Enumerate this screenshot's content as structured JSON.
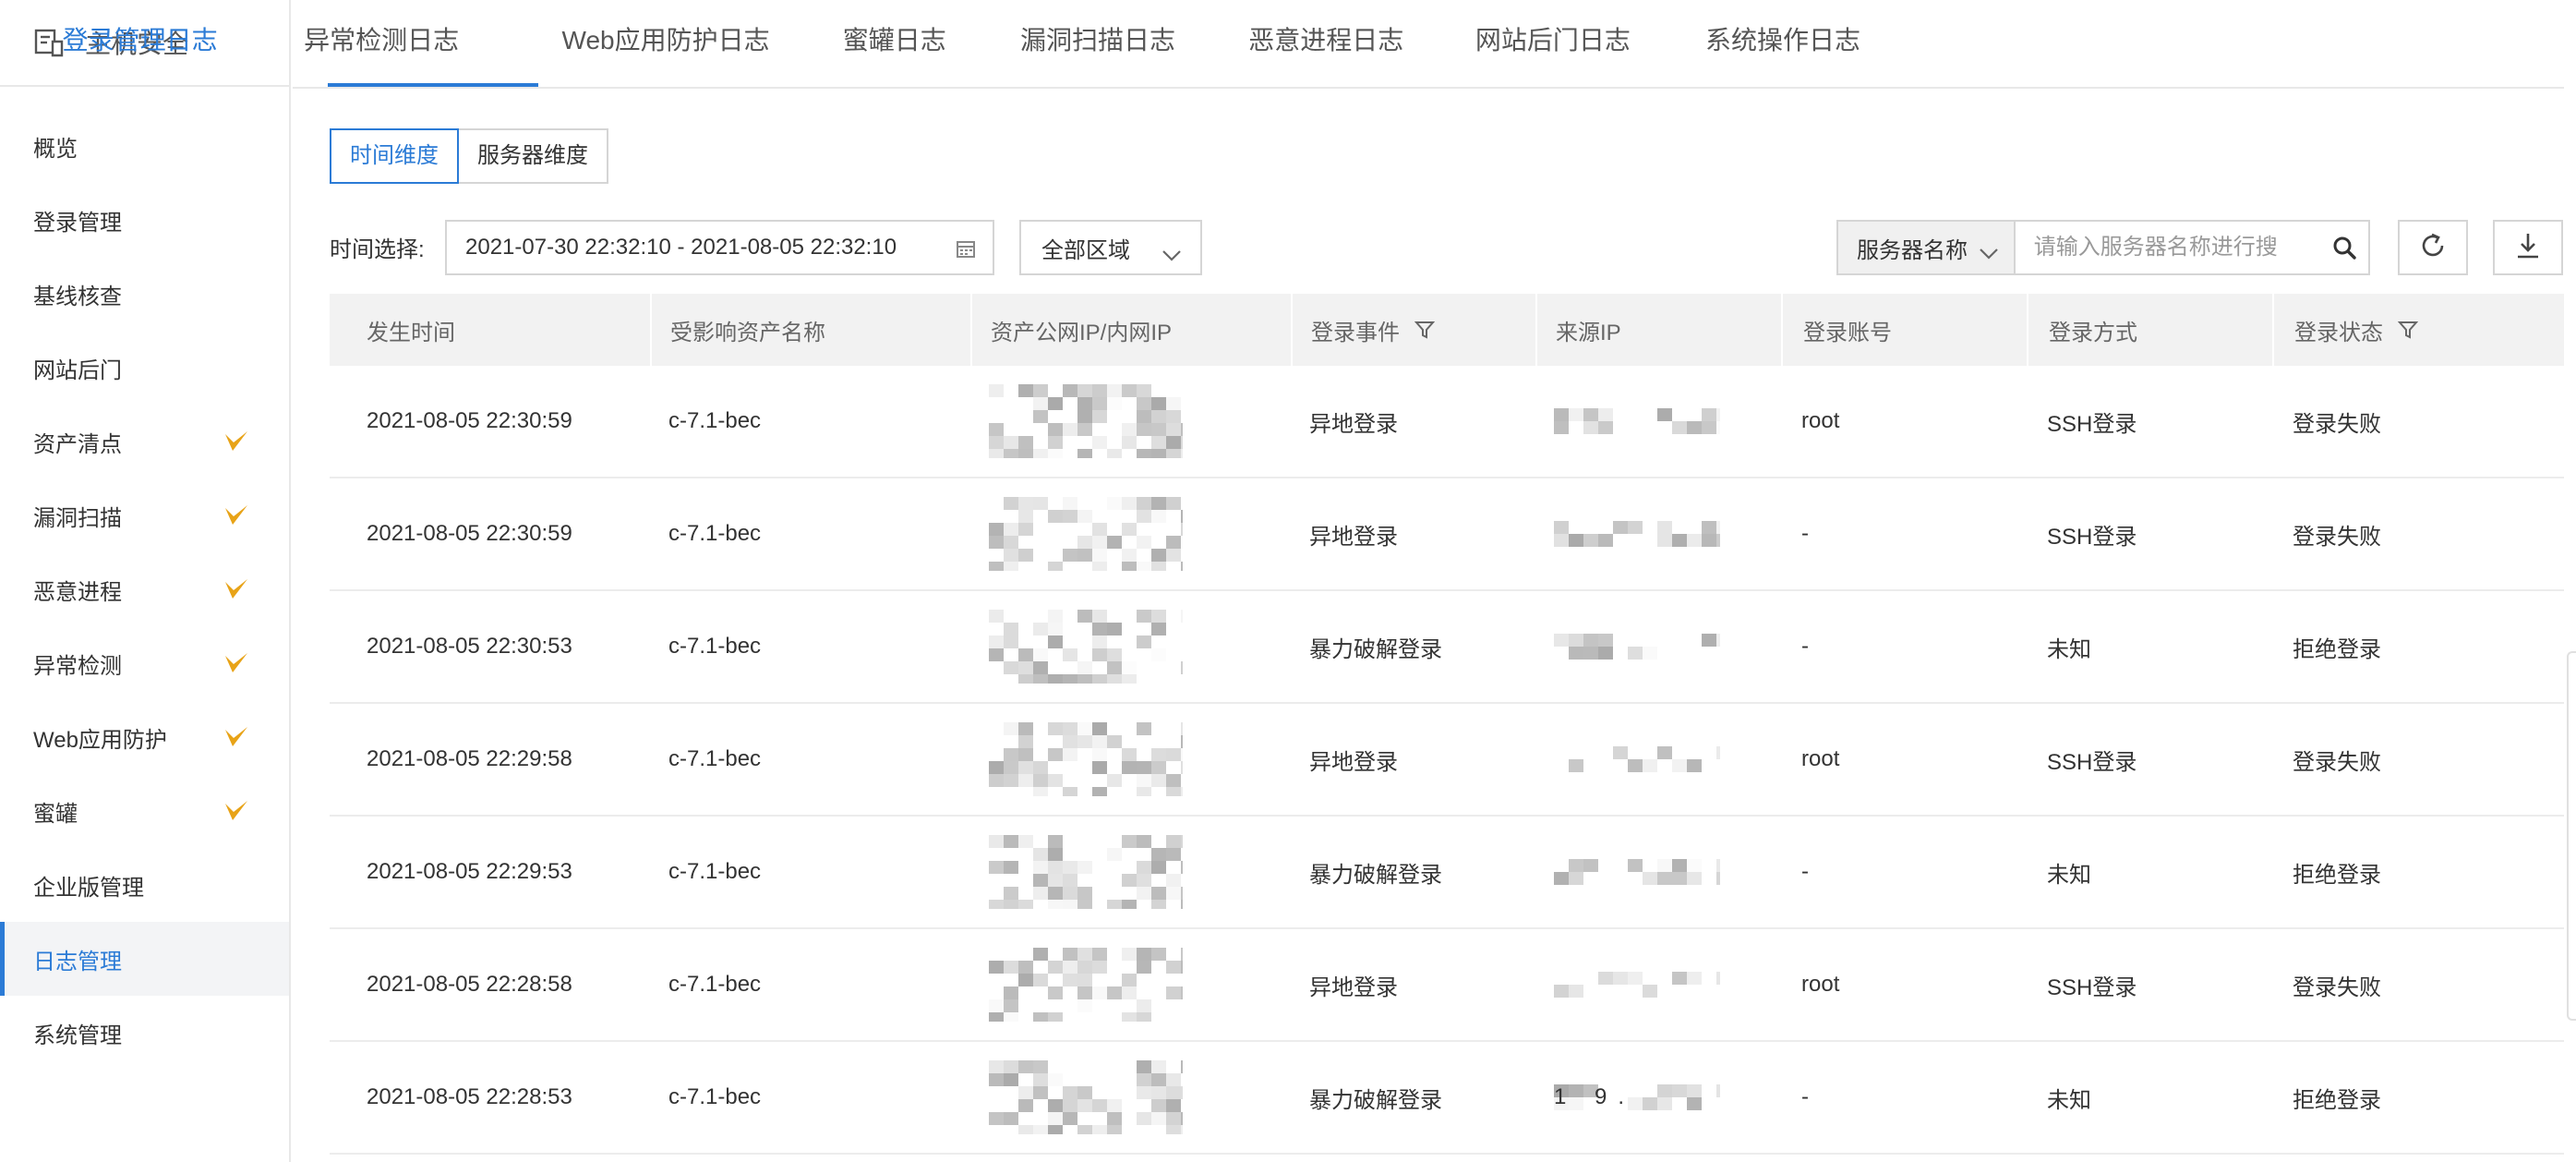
{
  "sidebar": {
    "title": "主机安全",
    "items": [
      {
        "label": "概览",
        "badge": false,
        "active": false
      },
      {
        "label": "登录管理",
        "badge": false,
        "active": false
      },
      {
        "label": "基线核查",
        "badge": false,
        "active": false
      },
      {
        "label": "网站后门",
        "badge": false,
        "active": false
      },
      {
        "label": "资产清点",
        "badge": true,
        "active": false
      },
      {
        "label": "漏洞扫描",
        "badge": true,
        "active": false
      },
      {
        "label": "恶意进程",
        "badge": true,
        "active": false
      },
      {
        "label": "异常检测",
        "badge": true,
        "active": false
      },
      {
        "label": "Web应用防护",
        "badge": true,
        "active": false
      },
      {
        "label": "蜜罐",
        "badge": true,
        "active": false
      },
      {
        "label": "企业版管理",
        "badge": false,
        "active": false
      },
      {
        "label": "日志管理",
        "badge": false,
        "active": true
      },
      {
        "label": "系统管理",
        "badge": false,
        "active": false
      }
    ]
  },
  "tabs": [
    "登录管理日志",
    "异常检测日志",
    "Web应用防护日志",
    "蜜罐日志",
    "漏洞扫描日志",
    "恶意进程日志",
    "网站后门日志",
    "系统操作日志"
  ],
  "view_toggle": {
    "time": "时间维度",
    "server": "服务器维度"
  },
  "filters": {
    "time_label": "时间选择:",
    "date_range": "2021-07-30 22:32:10 - 2021-08-05 22:32:10",
    "region": "全部区域",
    "search_field": "服务器名称",
    "search_placeholder": "请输入服务器名称进行搜"
  },
  "table": {
    "columns": [
      "发生时间",
      "受影响资产名称",
      "资产公网IP/内网IP",
      "登录事件",
      "来源IP",
      "登录账号",
      "登录方式",
      "登录状态"
    ],
    "rows": [
      {
        "time": "2021-08-05 22:30:59",
        "asset": "c-7.1-bec",
        "event": "异地登录",
        "source_ip": "",
        "account": "root",
        "method": "SSH登录",
        "status": "登录失败"
      },
      {
        "time": "2021-08-05 22:30:59",
        "asset": "c-7.1-bec",
        "event": "异地登录",
        "source_ip": "",
        "account": "-",
        "method": "SSH登录",
        "status": "登录失败"
      },
      {
        "time": "2021-08-05 22:30:53",
        "asset": "c-7.1-bec",
        "event": "暴力破解登录",
        "source_ip": "",
        "account": "-",
        "method": "未知",
        "status": "拒绝登录"
      },
      {
        "time": "2021-08-05 22:29:58",
        "asset": "c-7.1-bec",
        "event": "异地登录",
        "source_ip": "",
        "account": "root",
        "method": "SSH登录",
        "status": "登录失败"
      },
      {
        "time": "2021-08-05 22:29:53",
        "asset": "c-7.1-bec",
        "event": "暴力破解登录",
        "source_ip": "",
        "account": "-",
        "method": "未知",
        "status": "拒绝登录"
      },
      {
        "time": "2021-08-05 22:28:58",
        "asset": "c-7.1-bec",
        "event": "异地登录",
        "source_ip": "",
        "account": "root",
        "method": "SSH登录",
        "status": "登录失败"
      },
      {
        "time": "2021-08-05 22:28:53",
        "asset": "c-7.1-bec",
        "event": "暴力破解登录",
        "source_ip": "1 9.",
        "account": "-",
        "method": "未知",
        "status": "拒绝登录"
      }
    ]
  },
  "colors": {
    "accent": "#2b7bd6",
    "badge": "#e8a317"
  },
  "icons": [
    "host-security-icon",
    "v-badge-icon",
    "calendar-icon",
    "chevron-down-icon",
    "search-icon",
    "refresh-icon",
    "download-icon",
    "filter-icon"
  ]
}
